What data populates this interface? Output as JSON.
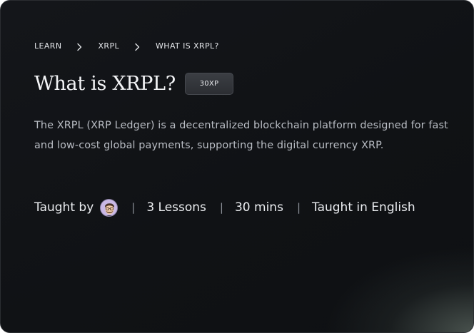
{
  "breadcrumb": {
    "items": [
      "LEARN",
      "XRPL",
      "WHAT IS XRPL?"
    ],
    "separator_icon": "chevron-right-icon"
  },
  "header": {
    "title": "What is XRPL?",
    "xp_badge": "30XP"
  },
  "description": "The XRPL (XRP Ledger) is a decentralized blockchain platform designed for fast and low-cost global payments, supporting the digital currency XRP.",
  "meta": {
    "taught_by_label": "Taught by",
    "instructor_avatar_icon": "instructor-avatar",
    "separator": "|",
    "lessons": "3 Lessons",
    "duration": "30 mins",
    "language": "Taught in English"
  },
  "colors": {
    "card_background": "#111316",
    "text_primary": "#f3f4f6",
    "text_secondary": "#b9bdc4",
    "badge_background": "#34363b",
    "avatar_background": "#c9b8e6"
  }
}
